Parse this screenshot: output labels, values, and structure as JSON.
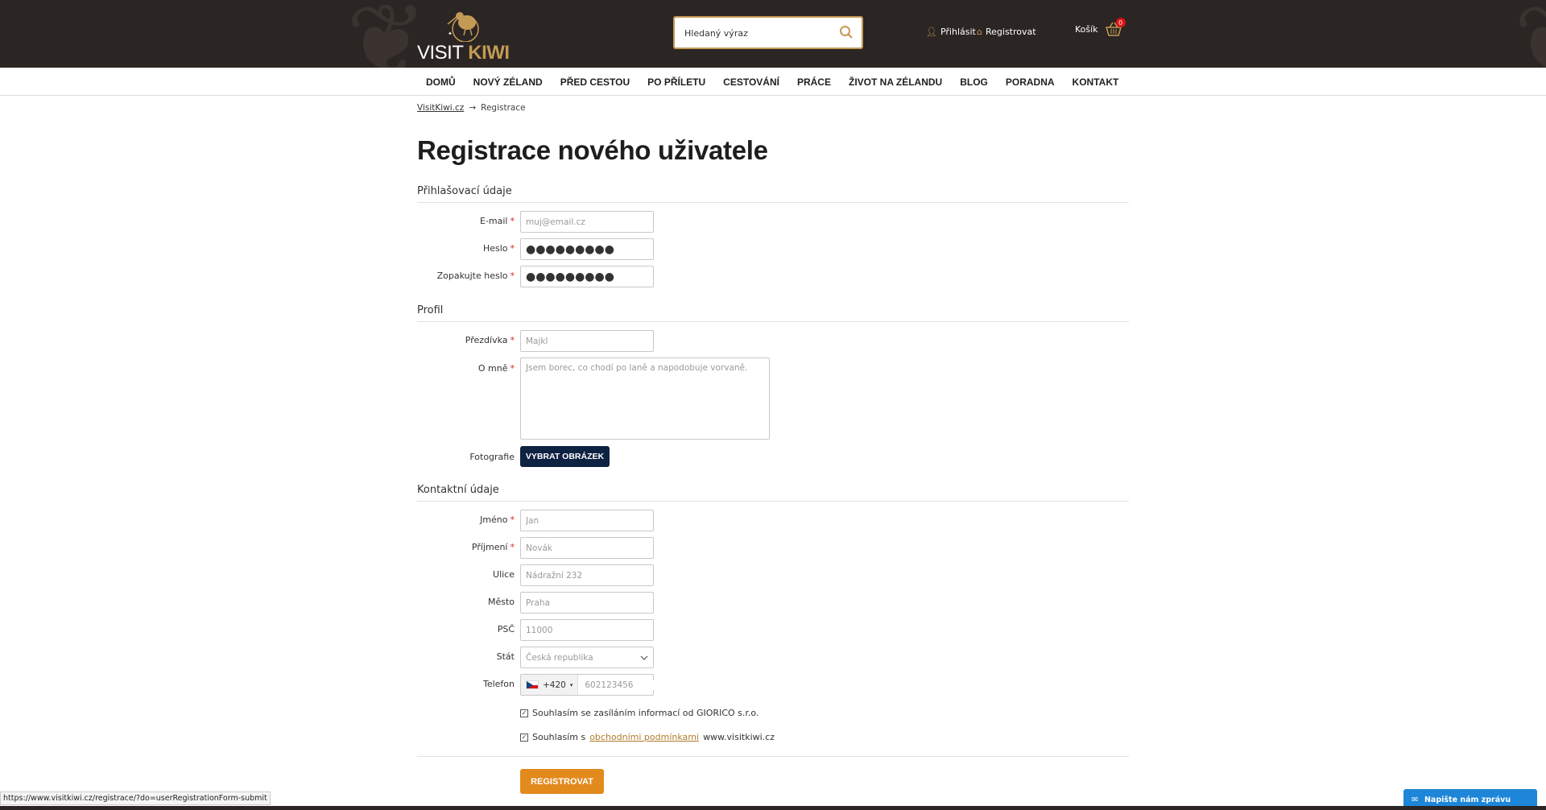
{
  "header": {
    "logo_word1": "VISIT",
    "logo_word2": "KIWI",
    "search_placeholder": "Hledaný výraz",
    "login_label": "Přihlásit",
    "register_label": "Registrovat",
    "cart_label": "Košík",
    "cart_count": "0"
  },
  "nav": {
    "items": [
      "DOMŮ",
      "NOVÝ ZÉLAND",
      "PŘED CESTOU",
      "PO PŘÍLETU",
      "CESTOVÁNÍ",
      "PRÁCE",
      "ŽIVOT NA ZÉLANDU",
      "BLOG",
      "PORADNA",
      "KONTAKT"
    ]
  },
  "breadcrumb": {
    "home": "VisitKiwi.cz",
    "arrow": "→",
    "current": "Registrace"
  },
  "page": {
    "title": "Registrace nového uživatele"
  },
  "login_section": {
    "heading": "Přihlašovací údaje",
    "email_label": "E-mail",
    "email_placeholder": "muj@email.cz",
    "password_label": "Heslo",
    "password_value": "●●●●●●●●●",
    "password2_label": "Zopakujte heslo",
    "password2_value": "●●●●●●●●●"
  },
  "profile_section": {
    "heading": "Profil",
    "nickname_label": "Přezdívka",
    "nickname_placeholder": "Majkl",
    "about_label": "O mně",
    "about_placeholder": "Jsem borec, co chodí po laně a napodobuje vorvaně.",
    "photo_label": "Fotografie",
    "photo_button": "VYBRAT OBRÁZEK"
  },
  "contact_section": {
    "heading": "Kontaktní údaje",
    "name_label": "Jméno",
    "name_placeholder": "Jan",
    "surname_label": "Příjmení",
    "surname_placeholder": "Novák",
    "street_label": "Ulice",
    "street_placeholder": "Nádražní 232",
    "city_label": "Město",
    "city_placeholder": "Praha",
    "zip_label": "PSČ",
    "zip_placeholder": "11000",
    "country_label": "Stát",
    "country_value": "Česká republika",
    "phone_label": "Telefon",
    "phone_code": "+420",
    "phone_placeholder": "602123456"
  },
  "consents": {
    "newsletter_text": "Souhlasím se zasíláním informací od GIORICO s.r.o.",
    "terms_prefix": "Souhlasím s",
    "terms_link": "obchodními podmínkami",
    "terms_suffix": "www.visitkiwi.cz"
  },
  "submit_label": "REGISTROVAT",
  "status_url": "https://www.visitkiwi.cz/registrace/?do=userRegistrationForm-submit",
  "chat_label": "Napište nám zprávu",
  "colors": {
    "header_bg": "#2b2523",
    "accent_gold": "#c39a55",
    "button_dark": "#0e2241",
    "button_orange": "#e38a1d",
    "required": "#d22222",
    "chat_blue": "#1e86d8"
  }
}
